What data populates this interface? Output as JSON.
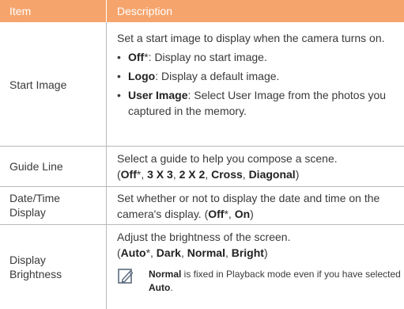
{
  "header": {
    "item": "Item",
    "description": "Description"
  },
  "rows": [
    {
      "item": "Start Image",
      "intro": "Set a start image to display when the camera turns on.",
      "bullets": [
        {
          "bold": "Off",
          "mark": "*",
          "text": ": Display no start image."
        },
        {
          "bold": "Logo",
          "mark": "",
          "text": ": Display a default image."
        },
        {
          "bold": "User Image",
          "mark": "",
          "text": ": Select User Image from the photos you captured in the memory."
        }
      ]
    },
    {
      "item": "Guide Line",
      "text": "Select a guide to help you compose a scene.",
      "options": [
        "Off",
        "3 X 3",
        "2 X 2",
        "Cross",
        "Diagonal"
      ]
    },
    {
      "item_line1": "Date/Time",
      "item_line2": "Display",
      "text": "Set whether or not to display the date and time on the camera's display.",
      "options": [
        "Off",
        "On"
      ]
    },
    {
      "item_line1": "Display",
      "item_line2": "Brightness",
      "text": "Adjust the brightness of the screen.",
      "options": [
        "Auto",
        "Dark",
        "Normal",
        "Bright"
      ],
      "note": {
        "bold1": "Normal",
        "mid": " is fixed in Playback mode even if you have selected ",
        "bold2": "Auto",
        "end": "."
      }
    }
  ],
  "default_mark": "*",
  "bullet_glyph": "•",
  "icon": "note-pencil-icon"
}
